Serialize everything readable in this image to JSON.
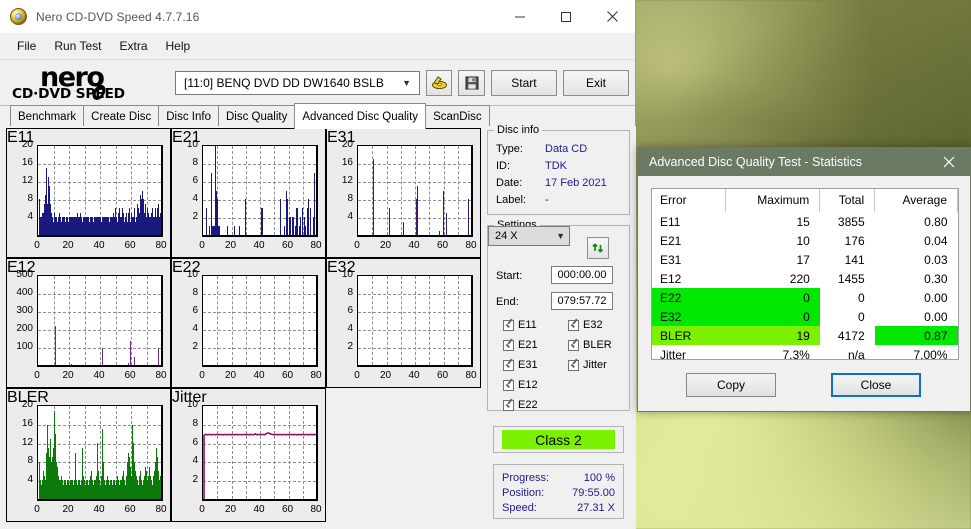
{
  "window": {
    "title": "Nero CD-DVD Speed 4.7.7.16",
    "icon": "nero-disc-icon",
    "minimize_label": "─",
    "maximize_label": "□",
    "close_label": "✕"
  },
  "menu": {
    "items": [
      "File",
      "Run Test",
      "Extra",
      "Help"
    ]
  },
  "brand": {
    "word1": "nero",
    "word2": "CD·DVD SPEED"
  },
  "toolbar": {
    "drive": "[11:0]   BENQ DVD DD DW1640 BSLB",
    "eject_icon": "eject-disc-icon",
    "save_icon": "save-floppy-icon",
    "start_label": "Start",
    "exit_label": "Exit"
  },
  "tabs": {
    "items": [
      "Benchmark",
      "Create Disc",
      "Disc Info",
      "Disc Quality",
      "Advanced Disc Quality",
      "ScanDisc"
    ],
    "active": "Advanced Disc Quality"
  },
  "disc_info": {
    "group_label": "Disc info",
    "rows": [
      {
        "label": "Type:",
        "value": "Data CD"
      },
      {
        "label": "ID:",
        "value": "TDK"
      },
      {
        "label": "Date:",
        "value": "17 Feb 2021"
      },
      {
        "label": "Label:",
        "value": "-"
      }
    ]
  },
  "settings": {
    "group_label": "Settings",
    "speed": "24 X",
    "refresh_icon": "refresh-arrows-icon",
    "start_label": "Start:",
    "start_value": "000:00.00",
    "end_label": "End:",
    "end_value": "079:57.72",
    "checkboxes_left": [
      "E11",
      "E21",
      "E31",
      "E12",
      "E22"
    ],
    "checkboxes_right": [
      "E32",
      "BLER",
      "Jitter"
    ]
  },
  "class_box": {
    "value": "Class 2",
    "color": "#7bf000"
  },
  "progress": {
    "rows": [
      {
        "label": "Progress:",
        "value": "100 %"
      },
      {
        "label": "Position:",
        "value": "79:55.00"
      },
      {
        "label": "Speed:",
        "value": "27.31 X"
      }
    ]
  },
  "dialog": {
    "title": "Advanced Disc Quality Test - Statistics",
    "close_icon": "close-icon",
    "columns": [
      "Error",
      "Maximum",
      "Total",
      "Average"
    ],
    "rows": [
      {
        "error": "E11",
        "maximum": "15",
        "total": "3855",
        "average": "0.80",
        "hl_left": false,
        "hl_avg": false
      },
      {
        "error": "E21",
        "maximum": "10",
        "total": "176",
        "average": "0.04",
        "hl_left": false,
        "hl_avg": false
      },
      {
        "error": "E31",
        "maximum": "17",
        "total": "141",
        "average": "0.03",
        "hl_left": false,
        "hl_avg": false
      },
      {
        "error": "E12",
        "maximum": "220",
        "total": "1455",
        "average": "0.30",
        "hl_left": false,
        "hl_avg": false
      },
      {
        "error": "E22",
        "maximum": "0",
        "total": "0",
        "average": "0.00",
        "hl_left": true,
        "hl_avg": false
      },
      {
        "error": "E32",
        "maximum": "0",
        "total": "0",
        "average": "0.00",
        "hl_left": true,
        "hl_avg": false
      },
      {
        "error": "BLER",
        "maximum": "19",
        "total": "4172",
        "average": "0.87",
        "hl_left": true,
        "hl_avg": true
      },
      {
        "error": "Jitter",
        "maximum": "7.3%",
        "total": "n/a",
        "average": "7.00%",
        "hl_left": false,
        "hl_avg": false
      }
    ],
    "copy_label": "Copy",
    "close_label": "Close"
  },
  "chart_data": [
    {
      "type": "bar",
      "id": "E11",
      "title": "E11",
      "color": "#1a1a7e",
      "filled": true,
      "xlabel": "",
      "ylabel": "",
      "xlim": [
        0,
        80
      ],
      "ylim": [
        0,
        20
      ],
      "xticks": [
        0,
        20,
        40,
        60,
        80
      ],
      "yticks": [
        4,
        8,
        12,
        16,
        20
      ],
      "grid": true,
      "values": [
        8,
        4,
        3,
        4,
        5,
        4,
        5,
        7,
        9,
        15,
        12,
        7,
        13,
        9,
        11,
        7,
        5,
        4,
        4,
        3,
        4,
        5,
        4,
        4,
        4,
        3,
        4,
        4,
        5,
        4,
        3,
        4,
        3,
        4,
        4,
        3,
        3,
        4,
        4,
        4,
        3,
        4,
        4,
        3,
        4,
        4,
        3,
        4,
        4,
        4,
        4,
        4,
        5,
        4,
        4,
        4,
        3,
        5,
        4,
        3,
        4,
        3,
        4,
        4,
        3,
        4,
        4,
        4,
        4,
        3,
        4,
        4,
        4,
        4,
        3,
        4,
        4,
        4,
        4,
        3,
        4,
        4,
        3,
        4,
        4,
        3,
        4,
        4,
        4,
        4,
        3,
        4,
        4,
        4,
        4,
        4,
        3,
        4,
        4,
        4,
        4,
        5,
        4,
        4,
        6,
        5,
        4,
        3,
        4,
        5,
        6,
        4,
        3,
        4,
        6,
        5,
        4,
        3,
        4,
        5,
        4,
        3,
        5,
        6,
        4,
        3,
        4,
        5,
        4,
        4,
        6,
        4,
        3,
        4,
        5,
        7,
        6,
        4,
        5,
        9,
        8,
        10,
        7,
        8,
        5,
        7,
        6,
        4,
        5,
        6,
        5,
        4,
        3,
        4,
        5,
        6,
        4,
        3,
        4,
        6,
        5,
        4,
        6,
        7,
        5,
        4,
        5,
        6,
        5
      ]
    },
    {
      "type": "bar",
      "id": "E21",
      "title": "E21",
      "color": "#1a1a7e",
      "filled": false,
      "xlabel": "",
      "ylabel": "",
      "xlim": [
        0,
        80
      ],
      "ylim": [
        0,
        10
      ],
      "xticks": [
        0,
        20,
        40,
        60,
        80
      ],
      "yticks": [
        2,
        4,
        6,
        8,
        10
      ],
      "grid": true,
      "values": [
        0,
        0,
        0,
        3,
        0,
        0,
        0,
        1,
        0,
        0,
        0,
        7,
        1,
        1,
        1,
        1,
        1,
        10,
        5,
        4,
        1,
        1,
        1,
        1,
        0,
        0,
        0,
        0,
        0,
        0,
        0,
        0,
        0,
        0,
        1,
        0,
        0,
        0,
        0,
        0,
        0,
        0,
        0,
        0,
        0,
        1,
        0,
        0,
        0,
        0,
        0,
        0,
        0,
        1,
        0,
        0,
        0,
        0,
        0,
        0,
        0,
        4,
        0,
        0,
        0,
        0,
        0,
        0,
        0,
        0,
        0,
        0,
        0,
        0,
        0,
        0,
        0,
        0,
        0,
        0,
        0,
        0,
        0,
        0,
        0,
        3,
        3,
        0,
        0,
        0,
        0,
        0,
        0,
        0,
        0,
        0,
        0,
        0,
        0,
        0,
        0,
        0,
        0,
        0,
        0,
        0,
        0,
        0,
        0,
        0,
        0,
        0,
        0,
        4,
        0,
        0,
        0,
        0,
        0,
        1,
        0,
        0,
        2,
        5,
        4,
        0,
        0,
        2,
        2,
        1,
        0,
        1,
        2,
        2,
        0,
        0,
        1,
        1,
        3,
        3,
        0,
        0,
        1,
        1,
        2,
        0,
        2,
        3,
        0,
        1,
        2,
        1,
        0,
        0,
        3,
        4,
        0,
        0,
        2,
        3,
        0,
        0,
        0,
        2,
        7,
        0,
        0,
        0,
        0
      ]
    },
    {
      "type": "bar",
      "id": "E31",
      "title": "E31",
      "color": "#3d1a6e",
      "filled": false,
      "xlabel": "",
      "ylabel": "",
      "xlim": [
        0,
        80
      ],
      "ylim": [
        0,
        20
      ],
      "xticks": [
        0,
        20,
        40,
        60,
        80
      ],
      "yticks": [
        4,
        8,
        12,
        16,
        20
      ],
      "grid": true,
      "values": [
        0,
        0,
        0,
        0,
        0,
        0,
        0,
        0,
        0,
        0,
        0,
        0,
        0,
        0,
        0,
        0,
        0,
        0,
        0,
        0,
        0,
        17,
        0,
        0,
        0,
        0,
        0,
        0,
        0,
        0,
        0,
        0,
        0,
        0,
        0,
        0,
        0,
        0,
        0,
        0,
        0,
        0,
        0,
        0,
        6,
        0,
        0,
        0,
        0,
        0,
        0,
        0,
        0,
        0,
        0,
        0,
        0,
        0,
        0,
        0,
        0,
        0,
        0,
        0,
        3,
        0,
        0,
        0,
        0,
        0,
        0,
        0,
        0,
        0,
        0,
        0,
        0,
        0,
        0,
        0,
        0,
        0,
        0,
        8,
        8,
        11,
        0,
        0,
        0,
        0,
        0,
        0,
        0,
        0,
        0,
        0,
        0,
        0,
        0,
        0,
        0,
        0,
        0,
        0,
        0,
        0,
        0,
        0,
        0,
        0,
        0,
        0,
        0,
        0,
        0,
        0,
        0,
        1,
        0,
        0,
        0,
        0,
        10,
        0,
        0,
        0,
        0,
        5,
        0,
        0,
        0,
        0,
        0,
        0,
        0,
        0,
        0,
        0,
        0,
        0,
        0,
        0,
        0,
        0,
        0,
        0,
        0,
        0,
        0,
        0,
        0,
        0,
        0,
        0,
        0,
        0,
        0,
        0,
        0,
        8,
        0,
        0,
        0,
        0,
        0
      ]
    },
    {
      "type": "bar",
      "id": "E12",
      "title": "E12",
      "color": "#6b2a7e",
      "filled": false,
      "xlabel": "",
      "ylabel": "",
      "xlim": [
        0,
        80
      ],
      "ylim": [
        0,
        500
      ],
      "xticks": [
        0,
        20,
        40,
        60,
        80
      ],
      "yticks": [
        100,
        200,
        300,
        400,
        500
      ],
      "grid": true,
      "values": [
        0,
        0,
        0,
        0,
        0,
        0,
        0,
        0,
        0,
        0,
        0,
        0,
        0,
        0,
        0,
        0,
        0,
        0,
        0,
        0,
        0,
        220,
        15,
        0,
        0,
        0,
        0,
        0,
        0,
        0,
        0,
        0,
        0,
        0,
        0,
        0,
        0,
        0,
        0,
        0,
        0,
        0,
        0,
        5,
        3,
        0,
        0,
        0,
        0,
        0,
        0,
        0,
        0,
        0,
        0,
        0,
        0,
        0,
        0,
        0,
        0,
        0,
        0,
        0,
        0,
        0,
        0,
        0,
        0,
        0,
        0,
        0,
        0,
        0,
        0,
        0,
        0,
        0,
        0,
        0,
        0,
        0,
        0,
        0,
        80,
        95,
        0,
        0,
        0,
        0,
        0,
        0,
        0,
        0,
        0,
        0,
        0,
        0,
        0,
        0,
        0,
        0,
        0,
        0,
        0,
        0,
        0,
        0,
        0,
        0,
        0,
        0,
        0,
        0,
        0,
        0,
        0,
        0,
        0,
        0,
        10,
        0,
        135,
        0,
        0,
        0,
        0,
        45,
        40,
        0,
        0,
        0,
        0,
        0,
        0,
        0,
        0,
        0,
        0,
        0,
        0,
        0,
        0,
        0,
        0,
        0,
        0,
        0,
        0,
        0,
        0,
        0,
        0,
        0,
        0,
        0,
        0,
        0,
        0,
        95,
        0,
        0,
        0,
        0,
        0
      ]
    },
    {
      "type": "bar",
      "id": "E22",
      "title": "E22",
      "color": "#1a1a7e",
      "filled": false,
      "xlabel": "",
      "ylabel": "",
      "xlim": [
        0,
        80
      ],
      "ylim": [
        0,
        10
      ],
      "xticks": [
        0,
        20,
        40,
        60,
        80
      ],
      "yticks": [
        2,
        4,
        6,
        8,
        10
      ],
      "grid": true,
      "values": []
    },
    {
      "type": "bar",
      "id": "E32",
      "title": "E32",
      "color": "#1a1a7e",
      "filled": false,
      "xlabel": "",
      "ylabel": "",
      "xlim": [
        0,
        80
      ],
      "ylim": [
        0,
        10
      ],
      "xticks": [
        0,
        20,
        40,
        60,
        80
      ],
      "yticks": [
        2,
        4,
        6,
        8,
        10
      ],
      "grid": true,
      "values": []
    },
    {
      "type": "bar",
      "id": "BLER",
      "title": "BLER",
      "color": "#0b7a0b",
      "filled": true,
      "xlabel": "",
      "ylabel": "",
      "xlim": [
        0,
        80
      ],
      "ylim": [
        0,
        20
      ],
      "xticks": [
        0,
        20,
        40,
        60,
        80
      ],
      "yticks": [
        4,
        8,
        12,
        16,
        20
      ],
      "grid": true,
      "values": [
        8,
        4,
        3,
        4,
        6,
        5,
        4,
        10,
        16,
        11,
        9,
        13,
        8,
        9,
        11,
        19,
        14,
        8,
        7,
        5,
        4,
        4,
        5,
        4,
        3,
        4,
        4,
        3,
        4,
        4,
        3,
        4,
        3,
        4,
        4,
        3,
        4,
        10,
        4,
        3,
        4,
        4,
        3,
        4,
        11,
        5,
        4,
        3,
        4,
        4,
        3,
        4,
        5,
        6,
        4,
        3,
        4,
        4,
        5,
        12,
        6,
        4,
        3,
        5,
        15,
        8,
        4,
        3,
        4,
        5,
        4,
        3,
        4,
        4,
        3,
        4,
        4,
        3,
        4,
        5,
        4,
        3,
        4,
        4,
        5,
        6,
        4,
        3,
        5,
        8,
        10,
        9,
        7,
        5,
        6,
        16,
        12,
        8,
        6,
        5,
        4,
        3,
        5,
        6,
        4,
        3,
        4,
        5,
        7,
        6,
        4,
        5,
        7,
        5,
        4,
        3,
        5,
        6,
        8,
        11,
        9,
        6,
        4,
        5,
        6
      ]
    },
    {
      "type": "line",
      "id": "Jitter",
      "title": "Jitter",
      "color": "#8e1255",
      "filled": false,
      "xlabel": "",
      "ylabel": "",
      "xlim": [
        0,
        80
      ],
      "ylim": [
        0,
        10
      ],
      "xticks": [
        0,
        20,
        40,
        60,
        80
      ],
      "yticks": [
        2,
        4,
        6,
        8,
        10
      ],
      "grid": true,
      "values": [
        6.9,
        6.95,
        6.9,
        6.95,
        6.9,
        6.95,
        6.9,
        6.95,
        6.9,
        6.95,
        6.9,
        6.95,
        6.9,
        6.95,
        6.9,
        6.95,
        6.9,
        6.95,
        6.9,
        6.95,
        6.9,
        6.95,
        6.9,
        6.95,
        6.9,
        6.95,
        6.9,
        7.0,
        6.9,
        6.95,
        6.9,
        6.95,
        6.9,
        7.05,
        7.1,
        7.0,
        6.95,
        6.9,
        6.95,
        6.9,
        6.95,
        6.9,
        6.95,
        6.9,
        6.95,
        6.9,
        6.95,
        6.9,
        6.95,
        6.9,
        6.95,
        6.9,
        6.95,
        6.9,
        6.95,
        6.9,
        6.95,
        6.9,
        6.95,
        6.9
      ]
    }
  ]
}
